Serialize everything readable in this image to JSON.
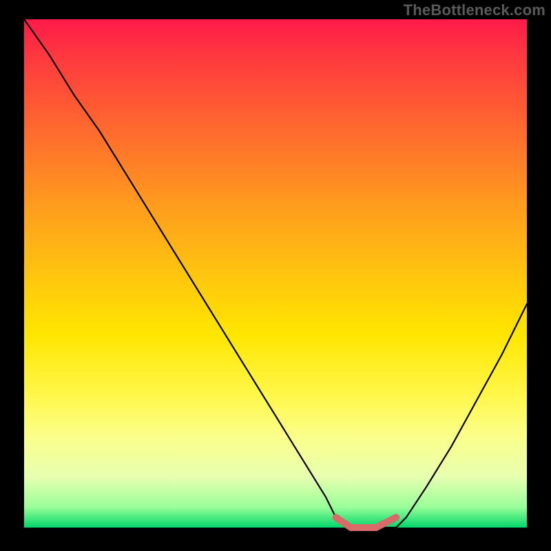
{
  "watermark": "TheBottleneck.com",
  "chart_data": {
    "type": "line",
    "title": "",
    "xlabel": "",
    "ylabel": "",
    "xlim": [
      0,
      100
    ],
    "ylim": [
      0,
      100
    ],
    "series": [
      {
        "name": "bottleneck-curve",
        "x": [
          0,
          5,
          10,
          15,
          20,
          25,
          30,
          35,
          40,
          45,
          50,
          55,
          60,
          62,
          65,
          70,
          74,
          76,
          80,
          85,
          90,
          95,
          100
        ],
        "y": [
          100,
          93,
          85,
          78,
          70,
          62,
          54,
          46,
          38,
          30,
          22,
          14,
          6,
          2,
          0,
          0,
          0,
          2,
          8,
          16,
          25,
          34,
          44
        ],
        "color": "#000000"
      },
      {
        "name": "optimal-range",
        "x": [
          62,
          65,
          70,
          74
        ],
        "y": [
          2,
          0,
          0,
          2
        ],
        "color": "#d86a6a"
      }
    ],
    "grid": false,
    "legend": false
  }
}
